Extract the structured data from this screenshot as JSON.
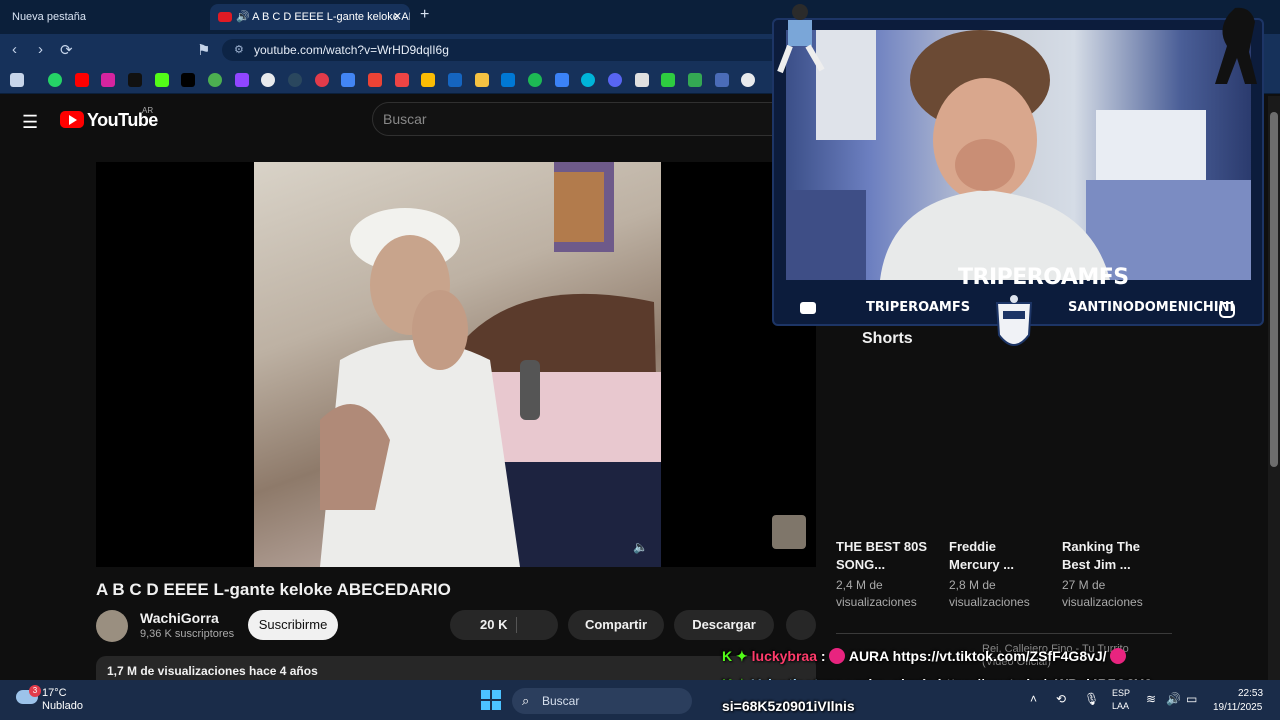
{
  "browser": {
    "tabs": [
      {
        "label": "Nueva pestaña"
      },
      {
        "label": "A B C D EEEE L-gante keloke ABECEDARIO"
      }
    ],
    "new_tab_icon": "plus-icon",
    "url": "youtube.com/watch?v=WrHD9dqlI6g"
  },
  "youtube": {
    "wordmark": "YouTube",
    "country": "AR",
    "search_placeholder": "Buscar",
    "video": {
      "title": "A B C D EEEE L-gante keloke ABECEDARIO",
      "channel": "WachiGorra",
      "subscribers": "9,36 K suscriptores",
      "subscribe_label": "Suscribirme",
      "likes": "20 K",
      "share_label": "Compartir",
      "download_label": "Descargar",
      "stats": "1,7 M de visualizaciones  hace 4 años"
    },
    "shorts": {
      "title": "Shorts",
      "items": [
        {
          "title": "THE BEST 80S SONG...",
          "views": "2,4 M de visualizaciones"
        },
        {
          "title": "Freddie Mercury ...",
          "views": "2,8 M de visualizaciones"
        },
        {
          "title": "Ranking The Best Jim ...",
          "views": "27 M de visualizaciones"
        }
      ]
    },
    "next_video_title": "Rei, Callejero Fino - Tu Turrito (Video Oficial)"
  },
  "overlay": {
    "streamer_name": "TRIPEROAMFS",
    "youtube_handle": "TRIPEROAMFS",
    "instagram_handle": "SANTINODOMENICHINI"
  },
  "chat": [
    {
      "user": "luckybraa",
      "message": "AURA https://vt.tiktok.com/ZSfF4G8vJ/"
    },
    {
      "user": "Valentinotune",
      "message": "mira. el mío https://youtu.be/oWPol4B7O8Y?",
      "continuation": "si=68K5z0901iVIlnis"
    }
  ],
  "taskbar": {
    "weather_temp": "17°C",
    "weather_desc": "Nublado",
    "weather_badge": "3",
    "search_label": "Buscar",
    "lang1": "ESP",
    "lang2": "LAA",
    "time": "22:53",
    "date": "19/11/2025"
  },
  "colors": {
    "youtube_red": "#ff0000",
    "chat_kick_green": "#53fc18",
    "browser_frame": "#16315a"
  }
}
